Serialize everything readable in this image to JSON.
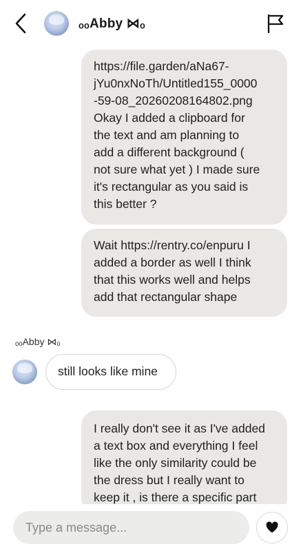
{
  "header": {
    "contact_name": "ₒₒAbby ⋈ₒ",
    "back_icon": "chevron-left-icon",
    "report_icon": "flag-icon"
  },
  "messages": [
    {
      "sender": "me",
      "text": "https://file.garden/aNa67-\njYu0nxNoTh/Untitled155_0000\n-59-08_20260208164802.png\nOkay I added a clipboard for\nthe text and am planning to\nadd a different background (\nnot sure what yet ) I made sure\nit's rectangular as you said is\nthis better ?"
    },
    {
      "sender": "me",
      "text": "Wait https://rentry.co/enpuru I\nadded a border as well I think\nthat this works well and helps\nadd that rectangular shape"
    },
    {
      "sender": "Abby",
      "sender_label": "ₒₒAbby ⋈ₒ",
      "text": "still looks like mine"
    },
    {
      "sender": "me",
      "text": "I really don't see it as I've added\na text box and everything I feel\nlike the only similarity could be\nthe dress but I really want to\nkeep it , is there a specific part"
    }
  ],
  "composer": {
    "placeholder": "Type a message...",
    "value": "",
    "like_icon": "heart-icon"
  },
  "colors": {
    "sent_bubble": "#e9e8e4",
    "received_bubble_border": "#d4d4d4",
    "input_background": "#ececeb"
  }
}
